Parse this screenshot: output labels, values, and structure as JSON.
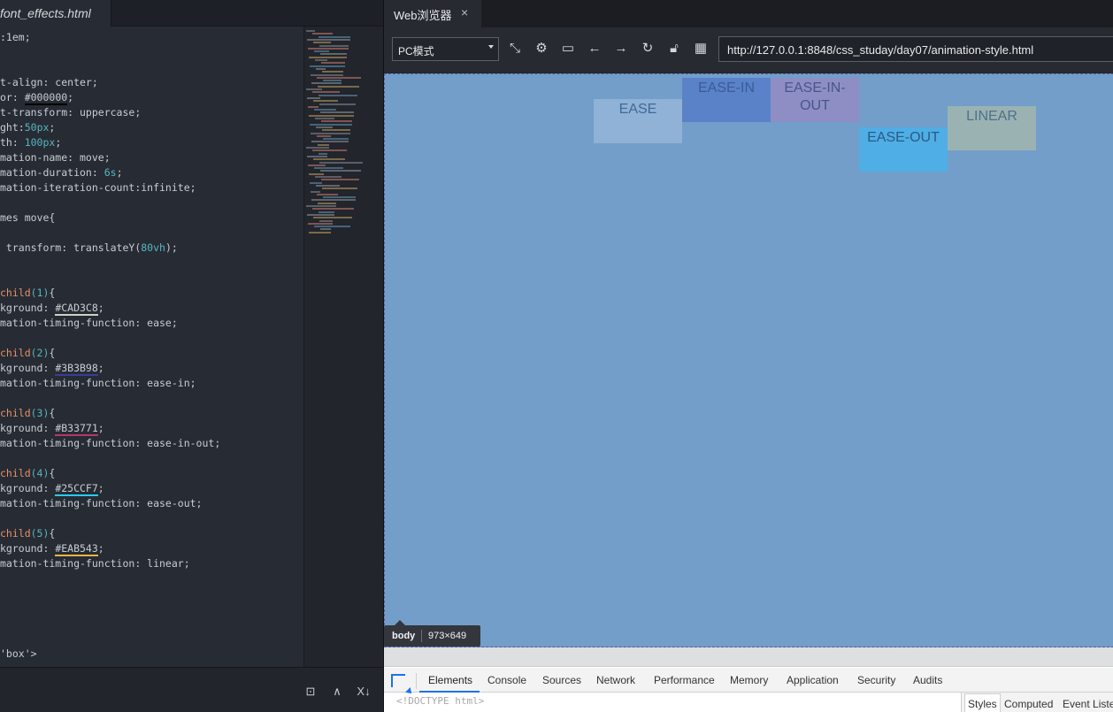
{
  "editor": {
    "tab_label": "font_effects.html",
    "code_lines": [
      [
        {
          "t": ":1em;"
        }
      ],
      [],
      [],
      [
        {
          "t": "t-align: center;"
        }
      ],
      [
        {
          "t": "or: "
        },
        {
          "t": "#000000",
          "c": "hex",
          "u": "#000000"
        },
        {
          "t": ";"
        }
      ],
      [
        {
          "t": "t-transform: uppercase;"
        }
      ],
      [
        {
          "t": "ght:"
        },
        {
          "t": "50",
          "c": "num"
        },
        {
          "t": "px",
          "c": "num"
        },
        {
          "t": ";"
        }
      ],
      [
        {
          "t": "th: "
        },
        {
          "t": "100",
          "c": "num"
        },
        {
          "t": "px",
          "c": "num"
        },
        {
          "t": ";"
        }
      ],
      [
        {
          "t": "mation-name: move;"
        }
      ],
      [
        {
          "t": "mation-duration: "
        },
        {
          "t": "6s",
          "c": "num"
        },
        {
          "t": ";"
        }
      ],
      [
        {
          "t": "mation-iteration-count:infinite;"
        }
      ],
      [],
      [
        {
          "t": "mes move{"
        }
      ],
      [],
      [
        {
          "t": " transform: translateY("
        },
        {
          "t": "80vh",
          "c": "num"
        },
        {
          "t": ");"
        }
      ],
      [],
      [],
      [
        {
          "t": "child",
          "c": "sel"
        },
        {
          "t": "(1)",
          "c": "num"
        },
        {
          "t": "{"
        }
      ],
      [
        {
          "t": "kground: "
        },
        {
          "t": "#CAD3C8",
          "c": "hex",
          "u": "#CAD3C8"
        },
        {
          "t": ";"
        }
      ],
      [
        {
          "t": "mation-timing-function: ease;"
        }
      ],
      [],
      [
        {
          "t": "child",
          "c": "sel"
        },
        {
          "t": "(2)",
          "c": "num"
        },
        {
          "t": "{"
        }
      ],
      [
        {
          "t": "kground: "
        },
        {
          "t": "#3B3B98",
          "c": "hex",
          "u": "#3B3B98"
        },
        {
          "t": ";"
        }
      ],
      [
        {
          "t": "mation-timing-function: ease-in;"
        }
      ],
      [],
      [
        {
          "t": "child",
          "c": "sel"
        },
        {
          "t": "(3)",
          "c": "num"
        },
        {
          "t": "{"
        }
      ],
      [
        {
          "t": "kground: "
        },
        {
          "t": "#B33771",
          "c": "hex",
          "u": "#B33771"
        },
        {
          "t": ";"
        }
      ],
      [
        {
          "t": "mation-timing-function: ease-in-out;"
        }
      ],
      [],
      [
        {
          "t": "child",
          "c": "sel"
        },
        {
          "t": "(4)",
          "c": "num"
        },
        {
          "t": "{"
        }
      ],
      [
        {
          "t": "kground: "
        },
        {
          "t": "#25CCF7",
          "c": "hex",
          "u": "#25CCF7"
        },
        {
          "t": ";"
        }
      ],
      [
        {
          "t": "mation-timing-function: ease-out;"
        }
      ],
      [],
      [
        {
          "t": "child",
          "c": "sel"
        },
        {
          "t": "(5)",
          "c": "num"
        },
        {
          "t": "{"
        }
      ],
      [
        {
          "t": "kground: "
        },
        {
          "t": "#EAB543",
          "c": "hex",
          "u": "#EAB543"
        },
        {
          "t": ";"
        }
      ],
      [
        {
          "t": "mation-timing-function: linear;"
        }
      ],
      [],
      [],
      [],
      [],
      [],
      [
        {
          "t": "'box'>"
        }
      ]
    ]
  },
  "browser": {
    "tab_label": "Web浏览器",
    "tab_close": "×",
    "mode_select_value": "PC模式",
    "url": "http://127.0.0.1:8848/css_studay/day07/animation-style.html",
    "boxes": [
      {
        "label": "ease",
        "bg": "#8fb2d6",
        "fg": "#3f6a97"
      },
      {
        "label": "ease-in",
        "bg": "#5a82c8",
        "fg": "#3a5c96"
      },
      {
        "label": "ease-in-out",
        "bg": "#8f8ec4",
        "fg": "#47558b"
      },
      {
        "label": "ease-out",
        "bg": "#4faee5",
        "fg": "#2a5a86"
      },
      {
        "label": "linear",
        "bg": "#9ab3b2",
        "fg": "#4f6f8d"
      }
    ],
    "tooltip": {
      "tag": "body",
      "size": "973×649"
    }
  },
  "devtools": {
    "tabs": [
      "Elements",
      "Console",
      "Sources",
      "Network",
      "Performance",
      "Memory",
      "Application",
      "Security",
      "Audits"
    ],
    "source_line": "<!DOCTYPE html>",
    "side_tabs": [
      "Styles",
      "Computed",
      "Event Listen"
    ]
  }
}
